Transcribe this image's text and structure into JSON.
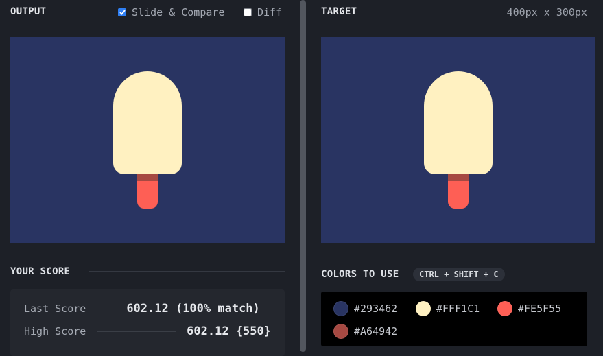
{
  "output_panel": {
    "title": "OUTPUT",
    "slide_compare": {
      "label": "Slide & Compare",
      "checked": true
    },
    "diff": {
      "label": "Diff",
      "checked": false
    }
  },
  "target_panel": {
    "title": "TARGET",
    "dimensions": "400px x 300px"
  },
  "score": {
    "title": "YOUR SCORE",
    "last_label": "Last Score",
    "last_value": "602.12 (100% match)",
    "high_label": "High Score",
    "high_value": "602.12 {550}"
  },
  "colors": {
    "title": "COLORS TO USE",
    "shortcut": "CTRL + SHIFT + C",
    "swatches": [
      {
        "hex": "#293462",
        "label": "#293462"
      },
      {
        "hex": "#FFF1C1",
        "label": "#FFF1C1"
      },
      {
        "hex": "#FE5F55",
        "label": "#FE5F55"
      },
      {
        "hex": "#A64942",
        "label": "#A64942"
      }
    ]
  },
  "theme": {
    "canvas_background": "#293462",
    "popsicle_body": "#FFF1C1",
    "stick_tip": "#A64942",
    "stick": "#FE5F55",
    "checkbox_accent": "#2f7ff3"
  }
}
